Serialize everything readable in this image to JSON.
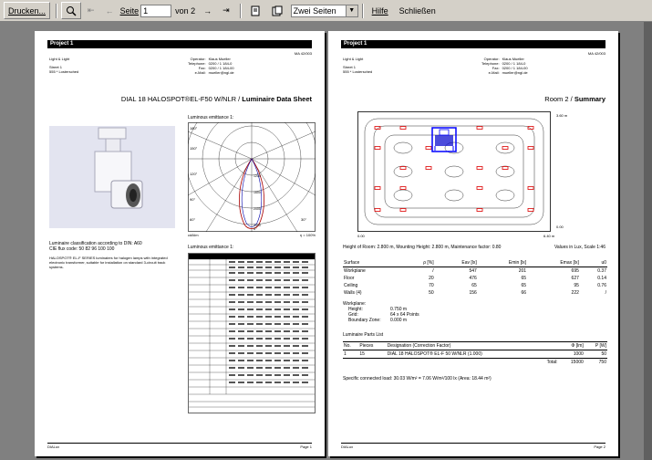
{
  "toolbar": {
    "print_label": "Drucken...",
    "page_label": "Seite",
    "page_value": "1",
    "page_of": "von 2",
    "view_mode": "Zwei Seiten",
    "help_label": "Hilfe",
    "close_label": "Schließen"
  },
  "page1": {
    "project": "Project 1",
    "doc_id": "MA 42/003",
    "company": "Light & Light",
    "street": "Street 1",
    "city": "555 * Lostersched",
    "contact_labels": [
      "Operator:",
      "Telephone:",
      "Fax:",
      "e-Mail:"
    ],
    "contact_values": [
      "Klaus Mueller",
      "0200 / 1 184-0",
      "0200 / 1 184-00",
      "mueller@ngl.de"
    ],
    "title_luminaire": "DIAL 18 HALOSPOT®EL-F50 W/NLR / ",
    "title_sheet": "Luminaire Data Sheet",
    "polar_title": "Luminous emittance 1:",
    "polar_labels": [
      "180°",
      "150°",
      "120°",
      "90°",
      "60°",
      "0°",
      "30°"
    ],
    "polar_values": [
      "1200",
      "1600",
      "2000",
      "2400"
    ],
    "polar_footer_left": "cd/klm",
    "polar_footer_right": "η = 100%",
    "table_title": "Luminous emittance 1:",
    "classification": "Luminaire classification according to DIN: A60",
    "cie": "CIE flux code: 50  82  96  100  100",
    "desc": "HALOSPOT® EL-F SERIES luminaires for halogen lamps with integrated electronic transformer, suitable for installation on standard 3-circuit track systems.",
    "footer_left": "DIALux",
    "footer_right": "Page 1"
  },
  "page2": {
    "project": "Project 1",
    "doc_id": "MA 42/003",
    "company": "Light & Light",
    "street": "Street 1",
    "city": "555 * Lostersched",
    "contact_labels": [
      "Operator:",
      "Telephone:",
      "Fax:",
      "e-Mail:"
    ],
    "contact_values": [
      "Klaus Mueller",
      "0200 / 1 184-0",
      "0200 / 1 184-00",
      "mueller@ngl.de"
    ],
    "title_room": "Room 2 / ",
    "title_summary": "Summary",
    "plan_y_top": "3.60 m",
    "plan_y_bottom": "0.00",
    "plan_x_left": "0.00",
    "plan_x_right": "6.40 m",
    "room_info": "Height of Room: 2.800 m, Mounting Height: 2.800 m, Maintenance factor: 0.80",
    "scale_info": "Values in Lux, Scale 1:46",
    "table_headers": [
      "Surface",
      "ρ [%]",
      "Eav [lx]",
      "Emin [lx]",
      "Emax [lx]",
      "u0"
    ],
    "table_rows": [
      [
        "Workplane",
        "/",
        "547",
        "201",
        "695",
        "0.37"
      ],
      [
        "Floor",
        "20",
        "476",
        "65",
        "627",
        "0.14"
      ],
      [
        "Ceiling",
        "70",
        "65",
        "65",
        "95",
        "0.76"
      ],
      [
        "Walls (4)",
        "50",
        "156",
        "66",
        "222",
        "/"
      ]
    ],
    "workplane_label": "Workplane:",
    "wp_height_label": "Height:",
    "wp_height_value": "0.750 m",
    "wp_grid_label": "Grid:",
    "wp_grid_value": "64 x 64 Points",
    "wp_boundary_label": "Boundary Zone:",
    "wp_boundary_value": "0.000 m",
    "parts_title": "Luminaire Parts List",
    "parts_headers": [
      "No.",
      "Pieces",
      "Designation (Correction Factor)",
      "Φ [lm]",
      "P [W]"
    ],
    "parts_row": [
      "1",
      "15",
      "DIAL 18 HALOSPOT® EL-F 50 W/NLR (1.000)",
      "1000",
      "50"
    ],
    "parts_total_label": "Total:",
    "parts_total_lm": "15000",
    "parts_total_w": "750",
    "specific_load": "Specific connected load: 30.03 W/m² = 7.06 W/m²/100 lx (Area: 18.44 m²)",
    "footer_left": "DIALux",
    "footer_right": "Page 2"
  }
}
